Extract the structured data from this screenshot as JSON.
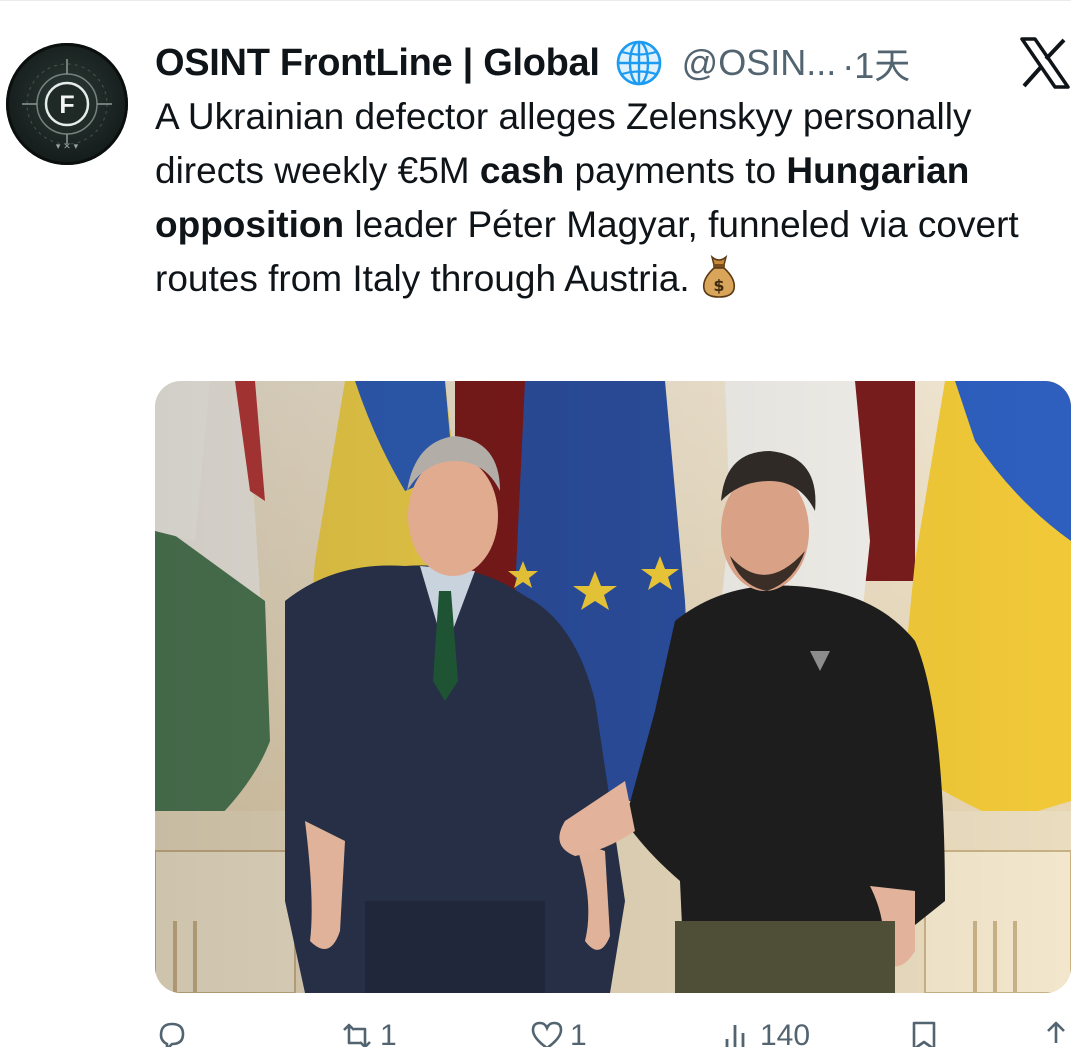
{
  "tweet": {
    "display_name": "OSINT FrontLine | Global",
    "handle": "@OSIN...",
    "time": "·1天",
    "text": {
      "p1": "A Ukrainian defector alleges Zelenskyy personally directs weekly €5M ",
      "b1": "cash",
      "p2": " payments to ",
      "b2": "Hungarian opposition",
      "p3": " leader Péter Magyar, funneled via covert routes from Italy through Austria."
    },
    "avatar_letter": "F",
    "emoji": "money-bag-icon"
  },
  "actions": {
    "reply": "",
    "retweet": "1",
    "like": "1",
    "views": "140",
    "bookmark": "",
    "share": ""
  },
  "colors": {
    "text": "#0f1419",
    "muted": "#536471",
    "globe": "#1d9bf0"
  }
}
